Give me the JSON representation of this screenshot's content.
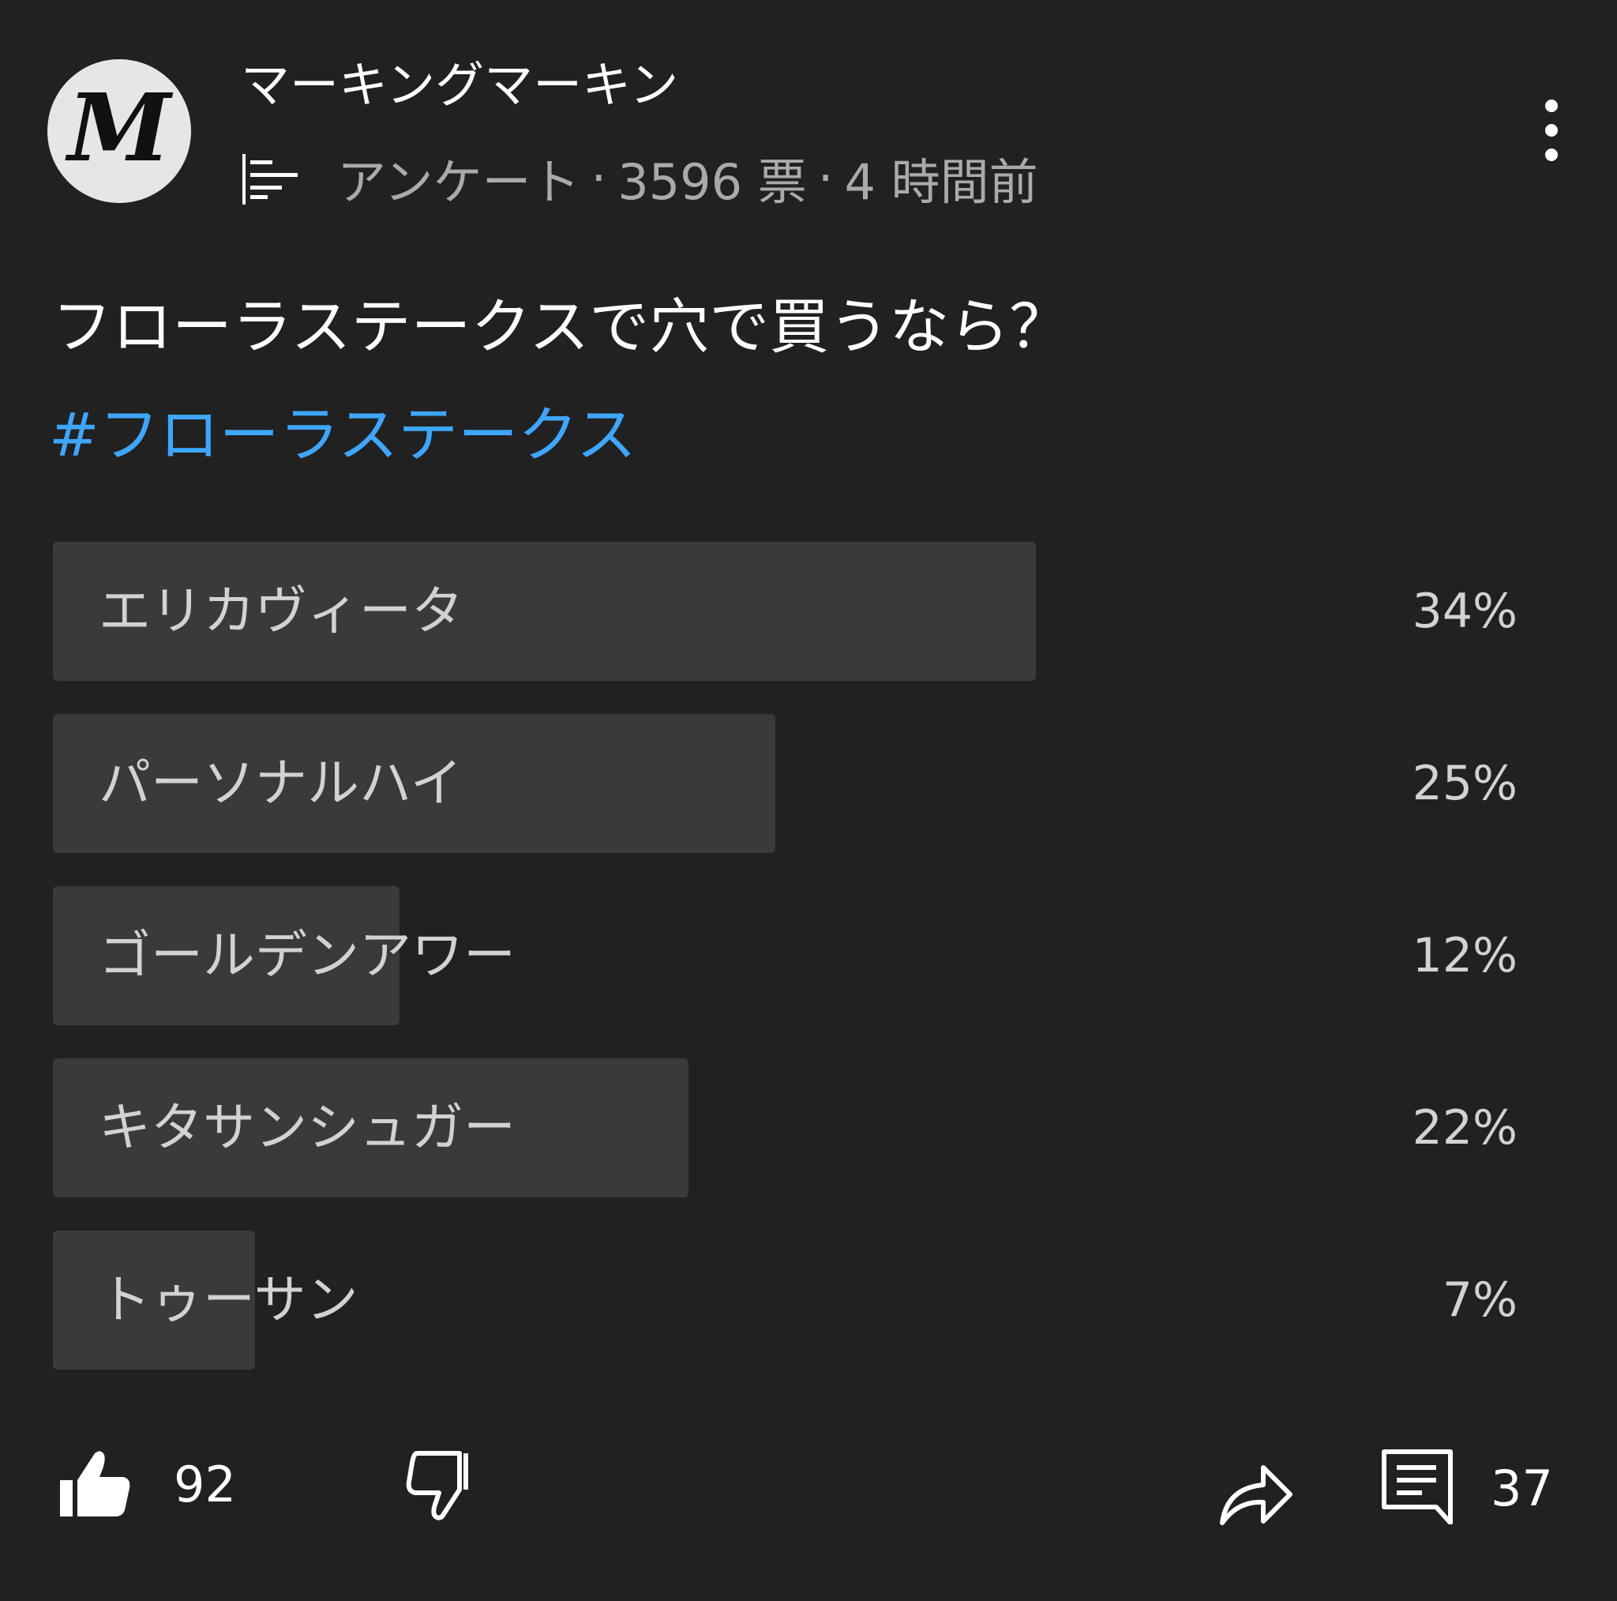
{
  "channel": {
    "name": "マーキングマーキン",
    "avatar_letter": "M"
  },
  "meta": {
    "type_label": "アンケート",
    "separator": "·",
    "votes": "3596 票",
    "time_ago": "4 時間前"
  },
  "post": {
    "question": "フローラステークスで穴で買うなら？",
    "hashtag": "#フローラステークス"
  },
  "poll": {
    "options": [
      {
        "label": "エリカヴィータ",
        "percent_text": "34%",
        "fill_fraction": 0.34
      },
      {
        "label": "パーソナルハイ",
        "percent_text": "25%",
        "fill_fraction": 0.25
      },
      {
        "label": "ゴールデンアワー",
        "percent_text": "12%",
        "fill_fraction": 0.12
      },
      {
        "label": "キタサンシュガー",
        "percent_text": "22%",
        "fill_fraction": 0.22
      },
      {
        "label": "トゥーサン",
        "percent_text": "7%",
        "fill_fraction": 0.07
      }
    ]
  },
  "actions": {
    "like_count": "92",
    "comment_count": "37",
    "icons": [
      "thumbs-up-icon",
      "thumbs-down-icon",
      "share-icon",
      "comment-icon",
      "more-vert-icon",
      "poll-icon"
    ]
  },
  "colors": {
    "background": "#212121",
    "poll_fill": "#3a3a3a",
    "hashtag": "#3ea6ff",
    "meta_text": "#aaaaaa",
    "option_text": "#d2d2d2"
  }
}
